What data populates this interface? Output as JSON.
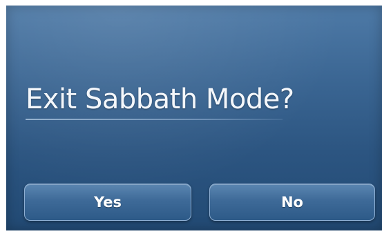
{
  "dialog": {
    "title": "Exit Sabbath Mode?",
    "yes_label": "Yes",
    "no_label": "No"
  },
  "colors": {
    "background_top": "#4e7aa7",
    "background_bottom": "#224a74",
    "button_border": "#8fb0d4",
    "text": "#ffffff"
  }
}
